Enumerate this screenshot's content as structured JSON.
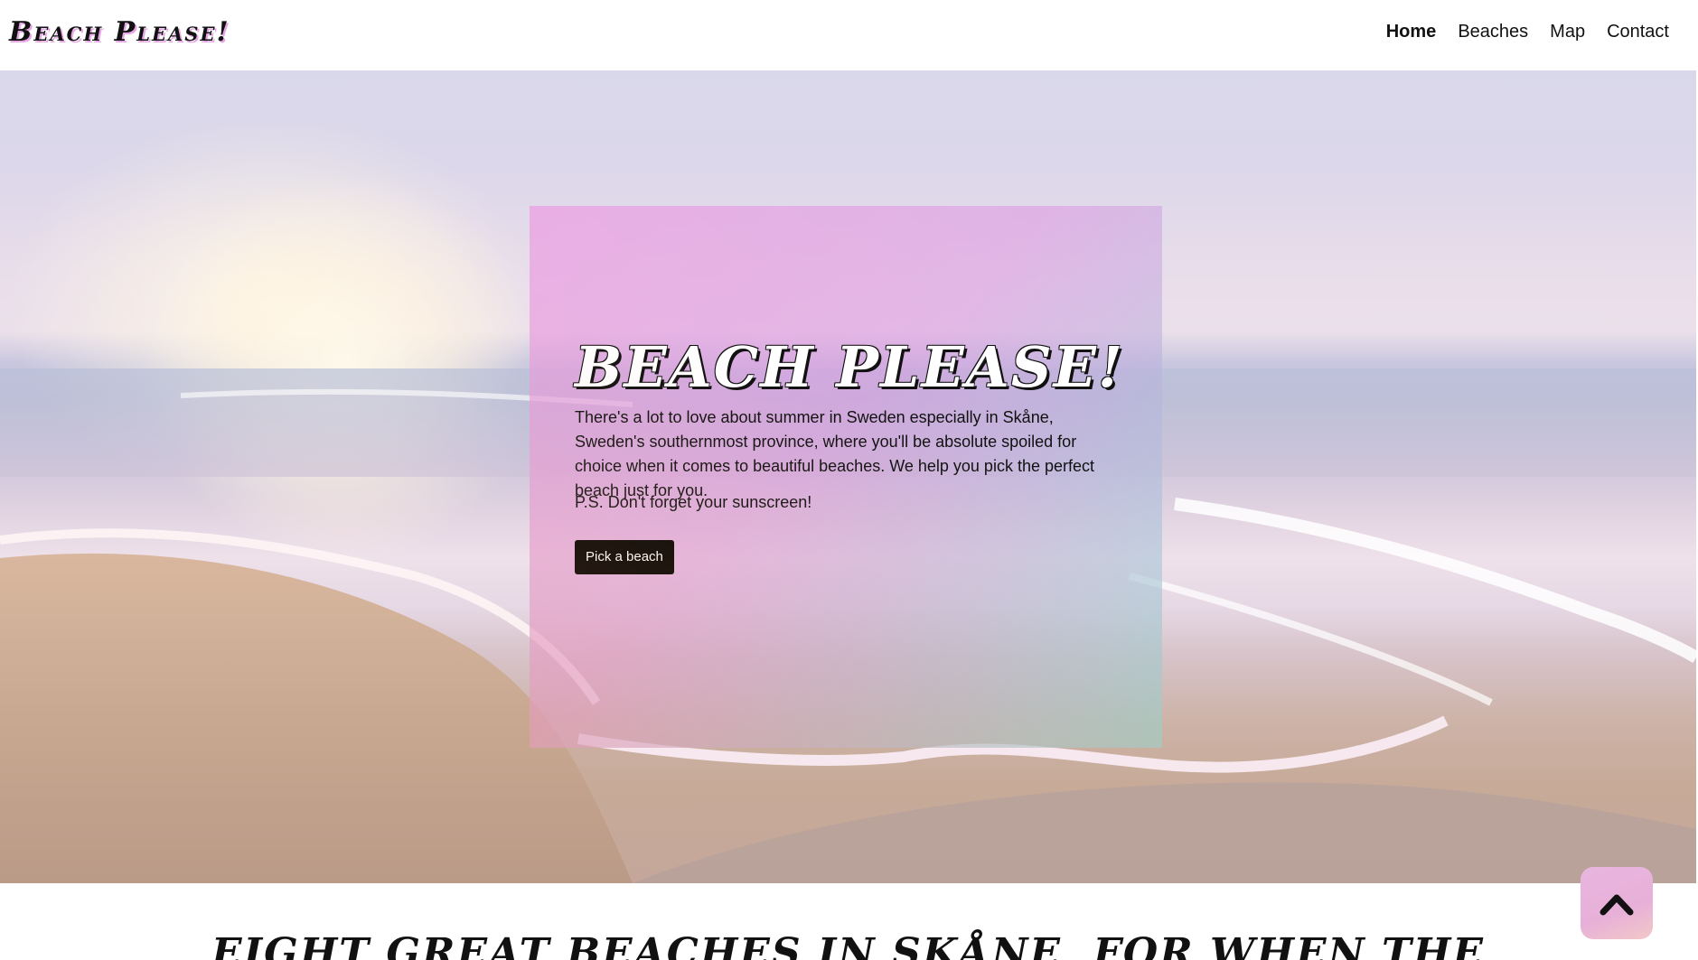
{
  "header": {
    "brand": "Beach Please!",
    "nav": [
      {
        "label": "Home",
        "active": true
      },
      {
        "label": "Beaches",
        "active": false
      },
      {
        "label": "Map",
        "active": false
      },
      {
        "label": "Contact",
        "active": false
      }
    ]
  },
  "hero": {
    "title": "Beach Please!",
    "body": "There's a lot to love about summer in Sweden especially in Skåne, Sweden's southernmost province, where you'll be absolute spoiled for choice when it comes to beautiful beaches. We help you pick the perfect beach just for you.",
    "ps": "P.S. Don't forget your sunscreen!",
    "button_label": "Pick a beach"
  },
  "section": {
    "title": "Eight great beaches in Skåne, for when the"
  },
  "icons": {
    "back_to_top": "chevron-up-icon"
  },
  "colors": {
    "accent_pink": "#e6a6e6",
    "button_bg": "#000000",
    "card_teal": "#8cd7d7"
  }
}
